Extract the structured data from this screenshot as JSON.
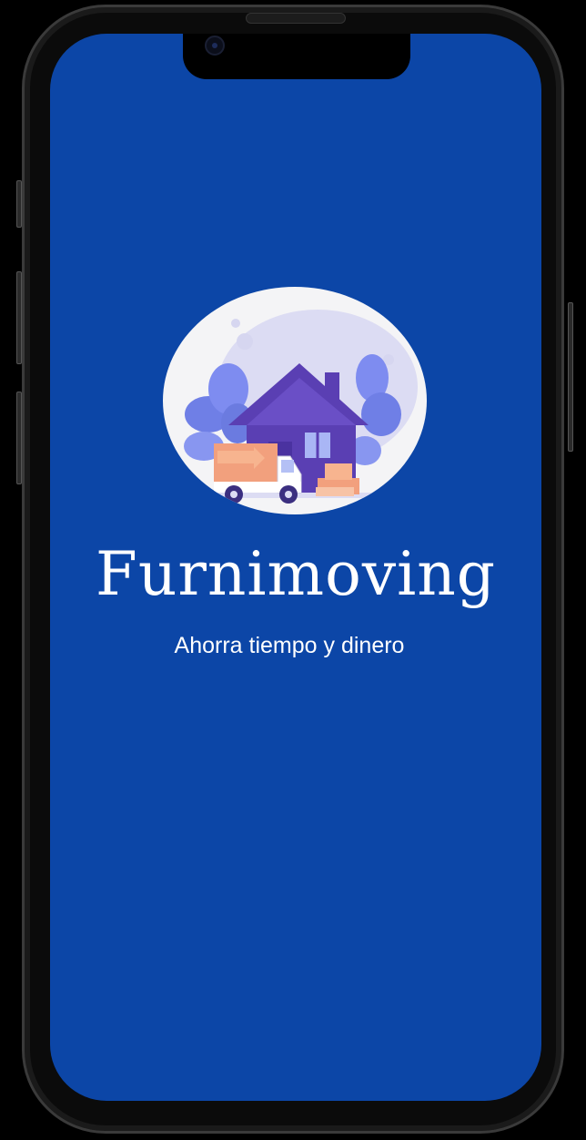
{
  "splash": {
    "app_name": "Furnimoving",
    "tagline": "Ahorra tiempo y dinero",
    "logo_icon": "house-moving-truck-icon"
  },
  "colors": {
    "background": "#0c46a7",
    "text": "#ffffff",
    "logo_background": "#f4f4f6",
    "house": "#5a3fb3",
    "foliage": "#6f7fe6",
    "truck_cargo": "#f2a07d",
    "boxes": "#f7b48f"
  }
}
